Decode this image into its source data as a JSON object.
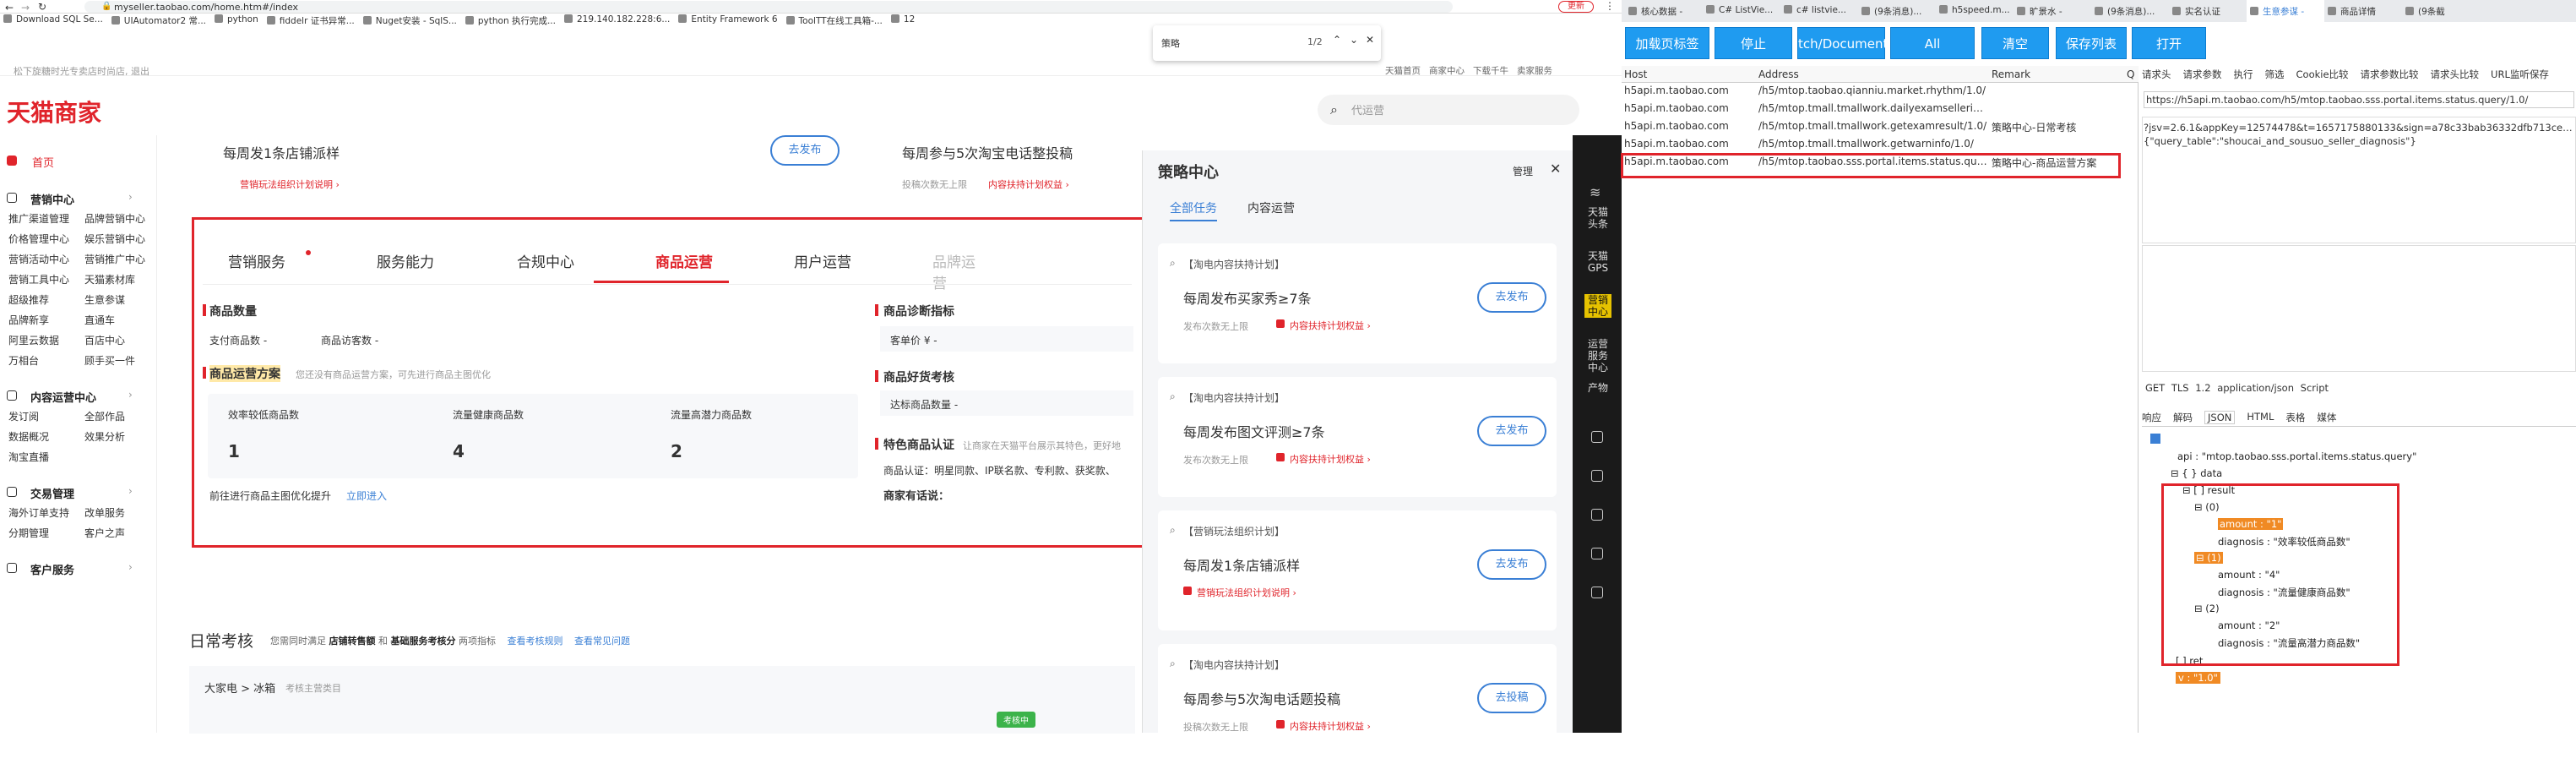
{
  "browser": {
    "url": "myseller.taobao.com/home.htm#/index",
    "update_btn": "更新"
  },
  "bookmarks": [
    "Download SQL Se...",
    "UIAutomator2 常...",
    "python",
    "fiddelr 证书异常...",
    "Nuget安装 - SqlS...",
    "python 执行完成...",
    "219.140.182.228:6...",
    "Entity Framework 6",
    "ToolTT在线工具箱-...",
    "12"
  ],
  "findbar": {
    "query": "策略",
    "count": "1/2"
  },
  "seller": {
    "topnav_left": "松下旋糖时光专卖店时尚店, 退出",
    "topnav_right": [
      "天猫首页",
      "商家中心",
      "下载千牛",
      "卖家服务"
    ],
    "logo": "天猫商家",
    "search_placeholder": "代运营",
    "sidebar": {
      "home": "首页",
      "sections": [
        {
          "title": "营销中心",
          "items": [
            "推广渠道管理",
            "品牌营销中心",
            "价格管理中心",
            "娱乐营销中心",
            "营销活动中心",
            "营销推广中心",
            "营销工具中心",
            "天猫素材库",
            "超级推荐",
            "生意参谋",
            "品牌新享",
            "直通车",
            "阿里云数据",
            "百店中心",
            "万相台",
            "顾手买一件"
          ]
        },
        {
          "title": "内容运营中心",
          "items": [
            "发订阅",
            "全部作品",
            "数据概况",
            "效果分析",
            "淘宝直播"
          ]
        },
        {
          "title": "交易管理",
          "items": [
            "海外订单支持",
            "改单服务",
            "分期管理",
            "客户之声"
          ]
        },
        {
          "title": "客户服务",
          "items": []
        }
      ]
    },
    "promo": [
      {
        "title": "每周发1条店铺派样",
        "btn": "去发布",
        "link": "营销玩法组织计划说明 ›"
      },
      {
        "title": "每周参与5次淘宝电话整投稿",
        "sub": "投稿次数无上限",
        "link": "内容扶持计划权益 ›"
      }
    ],
    "tabs": [
      "营销服务",
      "服务能力",
      "合规中心",
      "商品运营",
      "用户运营",
      "品牌运营"
    ],
    "active_tab": "商品运营",
    "panel": {
      "count_title": "商品数量",
      "count_items": [
        "支付商品数 -",
        "商品访客数 -"
      ],
      "plan_title": "商品运营方案",
      "plan_desc": "您还没有商品运营方案，可先进行商品主图优化",
      "cards": [
        {
          "label": "效率较低商品数",
          "value": "1"
        },
        {
          "label": "流量健康商品数",
          "value": "4"
        },
        {
          "label": "流量高潜力商品数",
          "value": "2"
        }
      ],
      "footer": "前往进行商品主图优化提升",
      "footer_link": "立即进入",
      "diag_title": "商品诊断指标",
      "diag_item": "客单价 ¥ -",
      "good_title": "商品好货考核",
      "good_item": "达标商品数量 -",
      "special_title": "特色商品认证",
      "special_desc": "让商家在天猫平台展示其特色，更好地",
      "special_items": "商品认证：明星同款、IP联名款、专利款、获奖款、",
      "voice": "商家有话说："
    },
    "daily": {
      "title": "日常考核",
      "desc": "您需同时满足",
      "desc2": "店铺转售额",
      "desc3": "和",
      "desc4": "基础服务考核分",
      "desc5": "两项指标",
      "link1": "查看考核规则",
      "link2": "查看常见问题",
      "crumb": "大家电 > 冰箱",
      "crumb2": "考核主营类目",
      "badge": "考核中"
    }
  },
  "strategy": {
    "title": "策略中心",
    "manage": "管理",
    "tabs": [
      "全部任务",
      "内容运营"
    ],
    "items": [
      {
        "tag": "【淘电内容扶持计划】",
        "title": "每周发布买家秀≥7条",
        "sub": "发布次数无上限",
        "link": "内容扶持计划权益 ›",
        "btn": "去发布"
      },
      {
        "tag": "【淘电内容扶持计划】",
        "title": "每周发布图文评测≥7条",
        "sub": "发布次数无上限",
        "link": "内容扶持计划权益 ›",
        "btn": "去发布"
      },
      {
        "tag": "【营销玩法组织计划】",
        "title": "每周发1条店铺派样",
        "sub": "",
        "link": "营销玩法组织计划说明 ›",
        "btn": "去发布"
      },
      {
        "tag": "【淘电内容扶持计划】",
        "title": "每周参与5次淘电话题投稿",
        "sub": "投稿次数无上限",
        "link": "内容扶持计划权益 ›",
        "btn": "去投稿"
      }
    ]
  },
  "rail": [
    "天猫头条",
    "天猫GPS",
    "营销中心",
    "运营服务中心",
    "产物"
  ],
  "tool": {
    "tabs": [
      "核心数据 -",
      "C# ListVie...",
      "c# listvie...",
      "(9条消息)...",
      "h5speed.m...",
      "旷景水 -",
      "(9条消息)...",
      "实名认证",
      "生意参谋 -",
      "商品详情",
      "(9条截"
    ],
    "buttons": [
      "加载页标签",
      "停止",
      "tch/Document",
      "All",
      "清空",
      "保存列表",
      "打开"
    ],
    "cols": [
      "Host",
      "Address",
      "Remark",
      "Q"
    ],
    "rows": [
      {
        "host": "h5api.m.taobao.com",
        "addr": "/h5/mtop.taobao.qianniu.market.rhythm/1.0/",
        "remark": ""
      },
      {
        "host": "h5api.m.taobao.com",
        "addr": "/h5/mtop.tmall.tmallwork.dailyexamsellerinf...",
        "remark": ""
      },
      {
        "host": "h5api.m.taobao.com",
        "addr": "/h5/mtop.tmall.tmallwork.getexamresult/1.0/",
        "remark": "策略中心-日常考核"
      },
      {
        "host": "h5api.m.taobao.com",
        "addr": "/h5/mtop.tmall.tmallwork.getwarninfo/1.0/",
        "remark": ""
      },
      {
        "host": "h5api.m.taobao.com",
        "addr": "/h5/mtop.taobao.sss.portal.items.status.que...",
        "remark": "策略中心-商品运营方案"
      }
    ],
    "req_tabs": [
      "请求头",
      "请求参数",
      "执行",
      "筛选",
      "Cookie比较",
      "请求参数比较",
      "请求头比较",
      "URL监听保存"
    ],
    "req_url": "https://h5api.m.taobao.com/h5/mtop.taobao.sss.portal.items.status.query/1.0/",
    "req_params": "?jsv=2.6.1&appKey=12574478&t=1657175880133&sign=a78c33bab36332dfb713ce7717",
    "req_data": "{\"query_table\":\"shoucai_and_sousuo_seller_diagnosis\"}",
    "status_line": "GET  TLS 1.2  application/json  Script",
    "resp_tabs": [
      "响应",
      "解码",
      "JSON",
      "HTML",
      "表格",
      "媒体"
    ],
    "json": {
      "api_line": "api : \"mtop.taobao.sss.portal.items.status.query\"",
      "data": "data",
      "result": "[ ] result",
      "entries": [
        {
          "idx": "(0)",
          "amount": "amount : \"1\"",
          "diag": "diagnosis : \"效率较低商品数\""
        },
        {
          "idx": "(1)",
          "amount": "amount : \"4\"",
          "diag": "diagnosis : \"流量健康商品数\""
        },
        {
          "idx": "(2)",
          "amount": "amount : \"2\"",
          "diag": "diagnosis : \"流量高潜力商品数\""
        }
      ],
      "ret": "[ ] ret",
      "v": "v : \"1.0\""
    }
  }
}
